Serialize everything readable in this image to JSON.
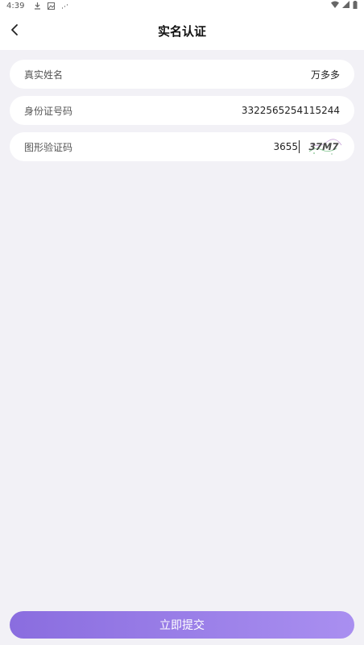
{
  "status_bar": {
    "time": "4:39",
    "icons": [
      "download-icon",
      "photo-icon",
      "signal-small-icon",
      "wifi-icon",
      "cell-signal-icon",
      "battery-icon"
    ]
  },
  "header": {
    "title": "实名认证",
    "back_icon": "chevron-left-icon"
  },
  "form": {
    "name": {
      "label": "真实姓名",
      "value": "万多多"
    },
    "id_number": {
      "label": "身份证号码",
      "value": "3322565254115244"
    },
    "captcha": {
      "label": "图形验证码",
      "value": "3655",
      "image_text": "37M7"
    }
  },
  "submit": {
    "label": "立即提交"
  },
  "colors": {
    "background": "#f2f1f6",
    "button_start": "#8a6ddf",
    "button_end": "#a98ff0"
  }
}
